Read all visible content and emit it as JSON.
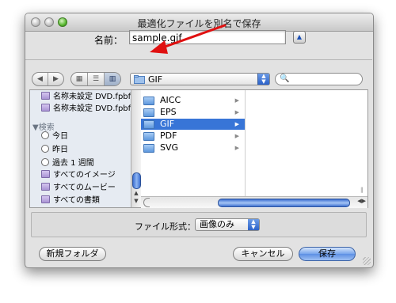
{
  "window": {
    "title": "最適化ファイルを別名で保存"
  },
  "save": {
    "name_label": "名前：",
    "file_name": "sample.gif"
  },
  "location": {
    "current_folder": "GIF",
    "search_placeholder": ""
  },
  "sidebar": {
    "items_top": [
      {
        "label": "名称未設定 DVD.fpbf"
      },
      {
        "label": "名称未設定 DVD.fpbf"
      }
    ],
    "search_heading": "検索",
    "search_items": [
      {
        "label": "今日",
        "icon": "clock-icon"
      },
      {
        "label": "昨日",
        "icon": "clock-icon"
      },
      {
        "label": "過去 1 週間",
        "icon": "clock-icon"
      },
      {
        "label": "すべてのイメージ",
        "icon": "smart-folder-icon"
      },
      {
        "label": "すべてのムービー",
        "icon": "smart-folder-icon"
      },
      {
        "label": "すべての書類",
        "icon": "smart-folder-icon"
      }
    ]
  },
  "columns": {
    "folders": [
      {
        "label": "AICC"
      },
      {
        "label": "EPS"
      },
      {
        "label": "GIF",
        "selected": true
      },
      {
        "label": "PDF"
      },
      {
        "label": "SVG"
      }
    ]
  },
  "format": {
    "label": "ファイル形式：",
    "value": "画像のみ"
  },
  "buttons": {
    "new_folder": "新規フォルダ",
    "cancel": "キャンセル",
    "save": "保存"
  },
  "colors": {
    "selection": "#3875d7",
    "annotation_arrow": "#e01010"
  }
}
